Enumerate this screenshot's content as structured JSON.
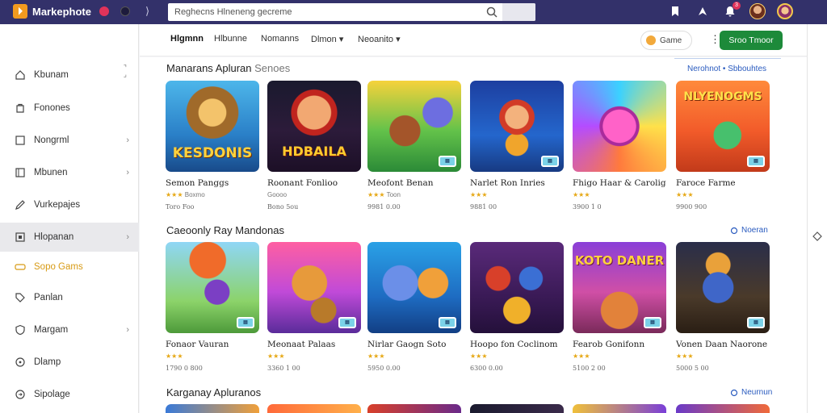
{
  "header": {
    "brand": "Markephote",
    "search_placeholder": "Reghecns Hlneneng gecreme",
    "notification_count": "3"
  },
  "sidebar": {
    "items": [
      {
        "label": "Kbunam"
      },
      {
        "label": "Fonones"
      },
      {
        "label": "Nongrml"
      },
      {
        "label": "Mbunen"
      },
      {
        "label": "Vurkepajes"
      },
      {
        "label": "Hlopanan"
      },
      {
        "label": "Sopo Gams"
      },
      {
        "label": "Panlan"
      },
      {
        "label": "Margam"
      },
      {
        "label": "Dlamp"
      },
      {
        "label": "Sipolage"
      }
    ]
  },
  "subheader": {
    "tabs": [
      "Hlgmnn",
      "Hlbunne",
      "Nomanns",
      "Dlmon",
      "Neoanito"
    ],
    "game_button": "Game",
    "primary_button": "Sroo Tmoor"
  },
  "sections": [
    {
      "title": "Manarans Apluran",
      "title_muted": "Senoes",
      "link": "Nerohnot • Sbbouhtes",
      "cards": [
        {
          "title": "Semon Panggs",
          "sub": "Boxmo",
          "stars": "★★★",
          "meta": "Toro Foo",
          "art": "KESDONIS"
        },
        {
          "title": "Roonant Fonlioo",
          "sub": "Goooo",
          "stars": "",
          "meta": "Bono 5ou",
          "art": "HDBAILA"
        },
        {
          "title": "Meofont Benan",
          "sub": "Toon",
          "stars": "★★★",
          "meta": "9981 0.00",
          "art": ""
        },
        {
          "title": "Narlet Ron Inries",
          "sub": "",
          "stars": "★★★",
          "meta": "9881 00",
          "art": ""
        },
        {
          "title": "Fhigo Haar & Carolig",
          "sub": "",
          "stars": "★★★",
          "meta": "3900 1 0",
          "art": ""
        },
        {
          "title": "Faroce Farme",
          "sub": "",
          "stars": "★★★",
          "meta": "9900 900",
          "art": "NLYENOGMS"
        }
      ]
    },
    {
      "title": "Caeoonly Ray Mandonas",
      "title_muted": "",
      "link": "Noeran",
      "cards": [
        {
          "title": "Fonaor Vauran",
          "sub": "",
          "stars": "★★★",
          "meta": "1790 0 800",
          "art": ""
        },
        {
          "title": "Meonaat Palaas",
          "sub": "",
          "stars": "★★★",
          "meta": "3360 1 00",
          "art": ""
        },
        {
          "title": "Nirlar Gaogn Soto",
          "sub": "",
          "stars": "★★★",
          "meta": "5950 0.00",
          "art": ""
        },
        {
          "title": "Hoopo fon Coclinom",
          "sub": "",
          "stars": "★★★",
          "meta": "6300 0.00",
          "art": ""
        },
        {
          "title": "Fearob Gonifonn",
          "sub": "",
          "stars": "★★★",
          "meta": "5100 2 00",
          "art": "KOTO DANER"
        },
        {
          "title": "Vonen Daan Naorone",
          "sub": "",
          "stars": "★★★",
          "meta": "5000 5 00",
          "art": ""
        }
      ]
    },
    {
      "title": "Karganay Apluranos",
      "title_muted": "",
      "link": "Neurnun",
      "cards": []
    }
  ]
}
